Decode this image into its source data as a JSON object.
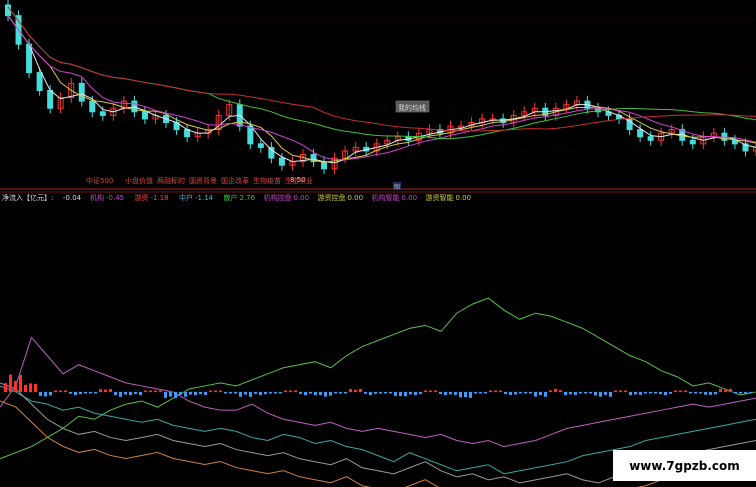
{
  "colors": {
    "background": "#000000",
    "grid_red": "#8b1a1a",
    "candle_up": "#ff3333",
    "candle_down": "#46dcdc",
    "ma_white": "#e8e8e8",
    "ma_yellow": "#d8c840",
    "ma_magenta": "#d040d0",
    "ma_green": "#40c040",
    "ma_red": "#c83030",
    "flow_green": "#5cbf4a",
    "flow_magenta": "#c060c0",
    "flow_cyan": "#3aa8a8",
    "flow_gray": "#9a9a9a",
    "flow_orange": "#d08040",
    "bar_pos": "#ff3030",
    "bar_neg": "#3c9cff"
  },
  "price_panel": {
    "price_note": "8.50",
    "tooltip": "我的均线",
    "date_marker": "图",
    "tags": [
      "中证500",
      "小盘价值",
      "两融标的",
      "国资背景",
      "国企改革",
      "生物疫苗",
      "生态农业"
    ]
  },
  "indicator_panel": {
    "title": "净流入【亿元】:",
    "value": "-0.04",
    "legend": [
      {
        "name": "机构",
        "value": "-0.45",
        "color": "#d040d0"
      },
      {
        "name": "游资",
        "value": "-1.18",
        "color": "#ff4040"
      },
      {
        "name": "中户",
        "value": "-1.14",
        "color": "#40b0d0"
      },
      {
        "name": "散户",
        "value": "2.76",
        "color": "#40c040"
      },
      {
        "name": "机构控盘",
        "value": "0.00",
        "color": "#d040d0"
      },
      {
        "name": "游资控盘",
        "value": "0.00",
        "color": "#d0d040"
      },
      {
        "name": "机构智能",
        "value": "0.00",
        "color": "#d040d0"
      },
      {
        "name": "游资智能",
        "value": "0.00",
        "color": "#d0d040"
      }
    ]
  },
  "watermark": "www.7gpzb.com",
  "chart_data": {
    "type": "line",
    "price": {
      "series_close": [
        10.2,
        9.4,
        8.6,
        8.1,
        7.6,
        7.9,
        8.3,
        7.8,
        7.5,
        7.4,
        7.6,
        7.8,
        7.5,
        7.3,
        7.4,
        7.2,
        7.0,
        6.8,
        6.9,
        7.0,
        7.4,
        7.7,
        7.1,
        6.6,
        6.5,
        6.2,
        6.0,
        6.1,
        6.3,
        6.1,
        5.9,
        6.2,
        6.4,
        6.5,
        6.4,
        6.6,
        6.7,
        6.8,
        6.7,
        6.9,
        7.0,
        6.9,
        7.1,
        7.1,
        7.2,
        7.3,
        7.3,
        7.2,
        7.4,
        7.5,
        7.6,
        7.4,
        7.6,
        7.7,
        7.8,
        7.6,
        7.5,
        7.4,
        7.3,
        7.0,
        6.8,
        6.7,
        6.9,
        7.0,
        6.7,
        6.6,
        6.8,
        6.9,
        6.7,
        6.6,
        6.4,
        6.5
      ],
      "ylim": [
        5.5,
        10.5
      ],
      "price_note": 8.5
    },
    "series": [
      {
        "name": "散户",
        "values": [
          -2.2,
          -2.0,
          -1.8,
          -1.5,
          -1.2,
          -0.8,
          -0.9,
          -0.6,
          -0.4,
          -0.3,
          -0.5,
          -0.2,
          0.1,
          0.2,
          0.3,
          0.2,
          0.4,
          0.6,
          0.8,
          0.9,
          1.0,
          0.8,
          1.2,
          1.5,
          1.7,
          1.9,
          2.1,
          2.2,
          2.0,
          2.6,
          2.9,
          3.1,
          2.7,
          2.4,
          2.6,
          2.5,
          2.3,
          2.1,
          1.8,
          1.5,
          1.2,
          1.0,
          0.7,
          0.5,
          0.2,
          0.3,
          0.1,
          -0.1,
          0.0
        ]
      },
      {
        "name": "机构",
        "values": [
          -0.5,
          0.2,
          1.8,
          1.2,
          0.6,
          0.9,
          0.7,
          0.5,
          0.3,
          0.2,
          0.1,
          0.0,
          -0.3,
          -0.5,
          -0.6,
          -0.6,
          -0.4,
          -0.7,
          -0.9,
          -1.0,
          -1.1,
          -1.0,
          -1.2,
          -1.3,
          -1.2,
          -1.3,
          -1.4,
          -1.5,
          -1.4,
          -1.6,
          -1.7,
          -1.6,
          -1.8,
          -1.7,
          -1.6,
          -1.4,
          -1.2,
          -1.1,
          -1.0,
          -0.9,
          -0.8,
          -0.7,
          -0.6,
          -0.5,
          -0.4,
          -0.5,
          -0.4,
          -0.3,
          -0.2
        ]
      },
      {
        "name": "中户",
        "values": [
          0.2,
          0.0,
          -0.3,
          -0.4,
          -0.6,
          -0.5,
          -0.7,
          -0.8,
          -0.9,
          -1.0,
          -0.9,
          -1.1,
          -1.2,
          -1.3,
          -1.2,
          -1.3,
          -1.5,
          -1.6,
          -1.4,
          -1.5,
          -1.7,
          -1.6,
          -1.8,
          -1.9,
          -2.1,
          -2.3,
          -2.0,
          -2.2,
          -2.4,
          -2.6,
          -2.5,
          -2.4,
          -2.7,
          -2.6,
          -2.5,
          -2.4,
          -2.3,
          -2.1,
          -2.0,
          -1.9,
          -1.8,
          -1.6,
          -1.5,
          -1.4,
          -1.3,
          -1.2,
          -1.1,
          -1.0,
          -0.9
        ]
      },
      {
        "name": "游资",
        "values": [
          0.3,
          0.1,
          -0.4,
          -0.9,
          -1.2,
          -1.4,
          -1.3,
          -1.5,
          -1.6,
          -1.5,
          -1.4,
          -1.6,
          -1.7,
          -1.8,
          -1.7,
          -1.9,
          -2.0,
          -2.1,
          -2.0,
          -2.2,
          -2.3,
          -2.4,
          -2.2,
          -2.5,
          -2.6,
          -2.7,
          -2.5,
          -2.3,
          -2.6,
          -2.8,
          -2.7,
          -2.9,
          -2.8,
          -3.0,
          -2.9,
          -2.8,
          -2.7,
          -2.9,
          -3.0,
          -2.8,
          -2.6,
          -2.5,
          -2.3,
          -2.2,
          -2.0,
          -1.9,
          -1.8,
          -1.7,
          -1.6
        ]
      },
      {
        "name": "净流入",
        "values": [
          1.1,
          0.6,
          -0.3,
          0.1,
          -0.2,
          -0.1,
          0.2,
          -0.3,
          -0.2,
          0.1,
          -0.4,
          -0.3,
          -0.2,
          0.1,
          -0.1,
          -0.3,
          -0.2,
          -0.1,
          0.1,
          -0.2,
          -0.3,
          -0.1,
          0.2,
          -0.2,
          -0.1,
          -0.3,
          -0.2,
          0.1,
          -0.2,
          -0.4,
          -0.1,
          0.1,
          -0.2,
          -0.1,
          -0.3,
          0.2,
          -0.2,
          -0.1,
          -0.3,
          0.1,
          -0.2,
          -0.1,
          -0.2,
          0.1,
          -0.1,
          -0.2,
          0.2,
          -0.1,
          -0.04
        ]
      }
    ],
    "ylim": [
      -3.2,
      3.4
    ]
  }
}
